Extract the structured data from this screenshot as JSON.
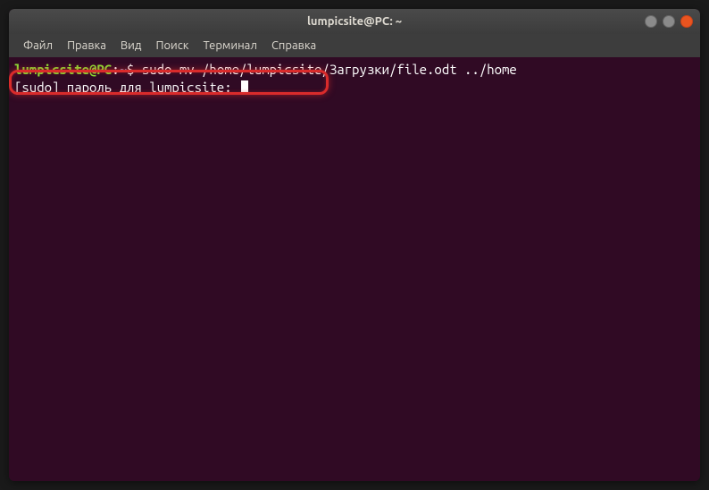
{
  "window": {
    "title": "lumpicsite@PC: ~"
  },
  "menubar": {
    "items": [
      {
        "label": "Файл"
      },
      {
        "label": "Правка"
      },
      {
        "label": "Вид"
      },
      {
        "label": "Поиск"
      },
      {
        "label": "Терминал"
      },
      {
        "label": "Справка"
      }
    ]
  },
  "terminal": {
    "prompt": {
      "user_host": "lumpicsite@PC",
      "separator": ":",
      "path": "~",
      "symbol": "$"
    },
    "command": "sudo mv /home/lumpicsite/Загрузки/file.odt ../home",
    "sudo_prompt": "[sudo] пароль для lumpicsite: "
  }
}
